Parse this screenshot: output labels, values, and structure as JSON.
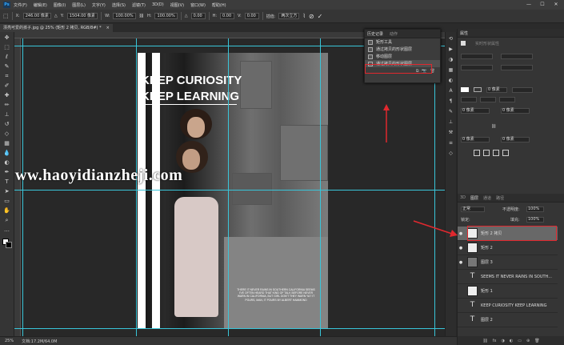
{
  "menubar": {
    "logo": "Ps",
    "items": [
      "文件(F)",
      "编辑(E)",
      "图像(I)",
      "图层(L)",
      "文字(Y)",
      "选择(S)",
      "滤镜(T)",
      "3D(D)",
      "视图(V)",
      "窗口(W)",
      "帮助(H)"
    ],
    "window_controls": [
      "—",
      "☐",
      "✕"
    ]
  },
  "options": {
    "x_label": "X:",
    "x_value": "246.00 像素",
    "y_label": "Y:",
    "y_value": "1504.00 像素",
    "w_label": "W:",
    "w_value": "100.00%",
    "h_label": "H:",
    "h_value": "100.00%",
    "angle_label": "△",
    "angle_value": "0.00",
    "hskew_label": "H:",
    "hskew_value": "0.00",
    "vskew_label": "V:",
    "vskew_value": "0.00",
    "interp_label": "插值:",
    "interp_value": "两次立方",
    "cancel_icon": "⊘",
    "commit_icon": "✓"
  },
  "document_tab": {
    "title": "漂亮可爱的孩子.jpg @ 25% (矩形 2 拷贝, RGB/8#) *",
    "close": "×"
  },
  "toolbar": {
    "tools": [
      {
        "name": "move-tool-icon",
        "glyph": "✥"
      },
      {
        "name": "marquee-tool-icon",
        "glyph": "⬚"
      },
      {
        "name": "lasso-tool-icon",
        "glyph": "ℓ"
      },
      {
        "name": "quick-select-tool-icon",
        "glyph": "✎"
      },
      {
        "name": "crop-tool-icon",
        "glyph": "⌗"
      },
      {
        "name": "eyedropper-tool-icon",
        "glyph": "✐"
      },
      {
        "name": "healing-tool-icon",
        "glyph": "✚"
      },
      {
        "name": "brush-tool-icon",
        "glyph": "✏"
      },
      {
        "name": "stamp-tool-icon",
        "glyph": "⊥"
      },
      {
        "name": "history-brush-tool-icon",
        "glyph": "↺"
      },
      {
        "name": "eraser-tool-icon",
        "glyph": "◇"
      },
      {
        "name": "gradient-tool-icon",
        "glyph": "▦"
      },
      {
        "name": "blur-tool-icon",
        "glyph": "💧"
      },
      {
        "name": "dodge-tool-icon",
        "glyph": "◐"
      },
      {
        "name": "pen-tool-icon",
        "glyph": "✒"
      },
      {
        "name": "type-tool-icon",
        "glyph": "T"
      },
      {
        "name": "path-select-tool-icon",
        "glyph": "➤"
      },
      {
        "name": "shape-tool-icon",
        "glyph": "▭"
      },
      {
        "name": "hand-tool-icon",
        "glyph": "✋"
      },
      {
        "name": "zoom-tool-icon",
        "glyph": "⌕"
      },
      {
        "name": "more-tools-icon",
        "glyph": "…"
      }
    ]
  },
  "image": {
    "headline_line1": "KEEP CURIOSITY",
    "headline_line2": "KEEP LEARNING",
    "paragraph": "THERE IT NEVER RAINS IN SOUTHERN CALIFORNIA SEEMS I'VE OFTEN HEARD THAT KIND OF TALK BEFORE NEVER WARN IN CALIFORNIA, BUT GIRL DON'T THEY WARN YA? IT POURS, MAN, IT POURS BY ALBERT HAMMOND",
    "watermark": "www.haoyidianzheji.com"
  },
  "history_panel": {
    "tab_active": "历史记录",
    "tab_other": "动作",
    "items": [
      "矩形工具",
      "通过拷贝的形状图层",
      "移动图层",
      "通过拷贝的形状图层"
    ],
    "footer_icons": [
      "⧉",
      "📷",
      "🗑"
    ]
  },
  "properties_panel": {
    "title": "属性",
    "subtitle": "实时形状属性",
    "stroke_value": "0 像素",
    "corner_value": "0 像素",
    "fields": [
      "0 像素",
      "0 像素",
      "0 像素",
      "0 像素"
    ]
  },
  "layers_panel": {
    "tabs": [
      "3D",
      "图层",
      "通道",
      "路径"
    ],
    "blend_mode": "正常",
    "opacity_label": "不透明度:",
    "opacity_value": "100%",
    "fill_label": "填充:",
    "fill_value": "100%",
    "lock_label": "锁定:",
    "layers": [
      {
        "name": "矩形 2 拷贝",
        "visible": true,
        "kind": "shape",
        "selected": true
      },
      {
        "name": "矩形 2",
        "visible": true,
        "kind": "shape",
        "selected": false
      },
      {
        "name": "图层 3",
        "visible": true,
        "kind": "pixel",
        "selected": false
      },
      {
        "name": "SEEMS IT NEVER RAINS IN SOUTH...",
        "visible": false,
        "kind": "text",
        "selected": false
      },
      {
        "name": "矩形 1",
        "visible": false,
        "kind": "shape",
        "selected": false
      },
      {
        "name": "KEEP CURIOSITY KEEP LEARNING",
        "visible": false,
        "kind": "text",
        "selected": false
      },
      {
        "name": "图层 2",
        "visible": false,
        "kind": "text",
        "selected": false
      }
    ],
    "footer_icons": [
      "⛓",
      "fx",
      "◑",
      "◐",
      "▭",
      "⊕",
      "🗑"
    ]
  },
  "status": {
    "zoom": "25%",
    "doc_size": "文档:17.2M/64.0M"
  }
}
